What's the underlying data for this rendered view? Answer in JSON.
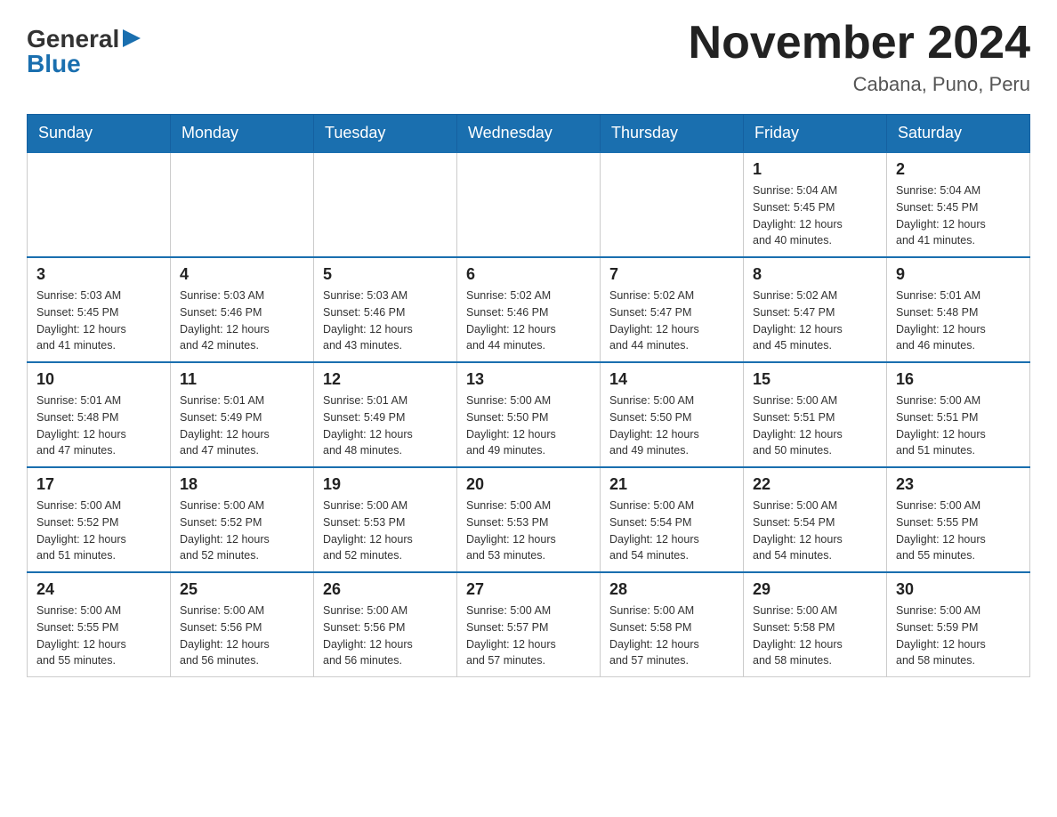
{
  "header": {
    "logo_general": "General",
    "logo_blue": "Blue",
    "title": "November 2024",
    "subtitle": "Cabana, Puno, Peru"
  },
  "days_of_week": [
    "Sunday",
    "Monday",
    "Tuesday",
    "Wednesday",
    "Thursday",
    "Friday",
    "Saturday"
  ],
  "weeks": [
    {
      "days": [
        {
          "number": "",
          "info": ""
        },
        {
          "number": "",
          "info": ""
        },
        {
          "number": "",
          "info": ""
        },
        {
          "number": "",
          "info": ""
        },
        {
          "number": "",
          "info": ""
        },
        {
          "number": "1",
          "info": "Sunrise: 5:04 AM\nSunset: 5:45 PM\nDaylight: 12 hours\nand 40 minutes."
        },
        {
          "number": "2",
          "info": "Sunrise: 5:04 AM\nSunset: 5:45 PM\nDaylight: 12 hours\nand 41 minutes."
        }
      ]
    },
    {
      "days": [
        {
          "number": "3",
          "info": "Sunrise: 5:03 AM\nSunset: 5:45 PM\nDaylight: 12 hours\nand 41 minutes."
        },
        {
          "number": "4",
          "info": "Sunrise: 5:03 AM\nSunset: 5:46 PM\nDaylight: 12 hours\nand 42 minutes."
        },
        {
          "number": "5",
          "info": "Sunrise: 5:03 AM\nSunset: 5:46 PM\nDaylight: 12 hours\nand 43 minutes."
        },
        {
          "number": "6",
          "info": "Sunrise: 5:02 AM\nSunset: 5:46 PM\nDaylight: 12 hours\nand 44 minutes."
        },
        {
          "number": "7",
          "info": "Sunrise: 5:02 AM\nSunset: 5:47 PM\nDaylight: 12 hours\nand 44 minutes."
        },
        {
          "number": "8",
          "info": "Sunrise: 5:02 AM\nSunset: 5:47 PM\nDaylight: 12 hours\nand 45 minutes."
        },
        {
          "number": "9",
          "info": "Sunrise: 5:01 AM\nSunset: 5:48 PM\nDaylight: 12 hours\nand 46 minutes."
        }
      ]
    },
    {
      "days": [
        {
          "number": "10",
          "info": "Sunrise: 5:01 AM\nSunset: 5:48 PM\nDaylight: 12 hours\nand 47 minutes."
        },
        {
          "number": "11",
          "info": "Sunrise: 5:01 AM\nSunset: 5:49 PM\nDaylight: 12 hours\nand 47 minutes."
        },
        {
          "number": "12",
          "info": "Sunrise: 5:01 AM\nSunset: 5:49 PM\nDaylight: 12 hours\nand 48 minutes."
        },
        {
          "number": "13",
          "info": "Sunrise: 5:00 AM\nSunset: 5:50 PM\nDaylight: 12 hours\nand 49 minutes."
        },
        {
          "number": "14",
          "info": "Sunrise: 5:00 AM\nSunset: 5:50 PM\nDaylight: 12 hours\nand 49 minutes."
        },
        {
          "number": "15",
          "info": "Sunrise: 5:00 AM\nSunset: 5:51 PM\nDaylight: 12 hours\nand 50 minutes."
        },
        {
          "number": "16",
          "info": "Sunrise: 5:00 AM\nSunset: 5:51 PM\nDaylight: 12 hours\nand 51 minutes."
        }
      ]
    },
    {
      "days": [
        {
          "number": "17",
          "info": "Sunrise: 5:00 AM\nSunset: 5:52 PM\nDaylight: 12 hours\nand 51 minutes."
        },
        {
          "number": "18",
          "info": "Sunrise: 5:00 AM\nSunset: 5:52 PM\nDaylight: 12 hours\nand 52 minutes."
        },
        {
          "number": "19",
          "info": "Sunrise: 5:00 AM\nSunset: 5:53 PM\nDaylight: 12 hours\nand 52 minutes."
        },
        {
          "number": "20",
          "info": "Sunrise: 5:00 AM\nSunset: 5:53 PM\nDaylight: 12 hours\nand 53 minutes."
        },
        {
          "number": "21",
          "info": "Sunrise: 5:00 AM\nSunset: 5:54 PM\nDaylight: 12 hours\nand 54 minutes."
        },
        {
          "number": "22",
          "info": "Sunrise: 5:00 AM\nSunset: 5:54 PM\nDaylight: 12 hours\nand 54 minutes."
        },
        {
          "number": "23",
          "info": "Sunrise: 5:00 AM\nSunset: 5:55 PM\nDaylight: 12 hours\nand 55 minutes."
        }
      ]
    },
    {
      "days": [
        {
          "number": "24",
          "info": "Sunrise: 5:00 AM\nSunset: 5:55 PM\nDaylight: 12 hours\nand 55 minutes."
        },
        {
          "number": "25",
          "info": "Sunrise: 5:00 AM\nSunset: 5:56 PM\nDaylight: 12 hours\nand 56 minutes."
        },
        {
          "number": "26",
          "info": "Sunrise: 5:00 AM\nSunset: 5:56 PM\nDaylight: 12 hours\nand 56 minutes."
        },
        {
          "number": "27",
          "info": "Sunrise: 5:00 AM\nSunset: 5:57 PM\nDaylight: 12 hours\nand 57 minutes."
        },
        {
          "number": "28",
          "info": "Sunrise: 5:00 AM\nSunset: 5:58 PM\nDaylight: 12 hours\nand 57 minutes."
        },
        {
          "number": "29",
          "info": "Sunrise: 5:00 AM\nSunset: 5:58 PM\nDaylight: 12 hours\nand 58 minutes."
        },
        {
          "number": "30",
          "info": "Sunrise: 5:00 AM\nSunset: 5:59 PM\nDaylight: 12 hours\nand 58 minutes."
        }
      ]
    }
  ]
}
